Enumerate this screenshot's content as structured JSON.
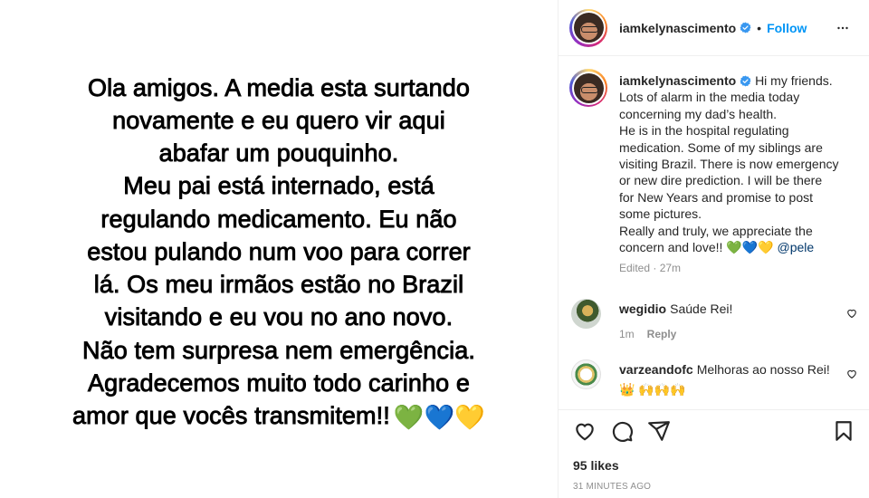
{
  "story": {
    "lines": [
      "Ola amigos. A media esta surtando",
      "novamente e eu quero vir aqui",
      "abafar um pouquinho.",
      "Meu pai está internado, está",
      "regulando medicamento. Eu não",
      "estou pulando num voo para correr",
      "lá. Os meu irmãos estão no Brazil",
      "visitando e eu vou no ano novo.",
      "Não tem surpresa nem emergência.",
      "Agradecemos muito todo carinho e",
      "amor que vocês transmitem!!"
    ],
    "hearts": "💚💙💛"
  },
  "header": {
    "username": "iamkelynascimento",
    "separator": "•",
    "follow_label": "Follow"
  },
  "caption": {
    "username": "iamkelynascimento",
    "lines": [
      "Hi my friends.",
      "Lots of alarm in the media today",
      "concerning my dad’s health.",
      "He is in the hospital regulating",
      "medication. Some of my siblings are",
      "visiting Brazil. There is now emergency",
      "or new dire prediction. I will be there",
      "for New Years and promise to post",
      "some pictures.",
      "Really and truly, we appreciate the",
      "concern and love!! 💚💙💛"
    ],
    "mention": "@pele",
    "meta": "Edited · 27m"
  },
  "comments": [
    {
      "username": "wegidio",
      "text": "Saúde Rei!",
      "time": "1m",
      "reply_label": "Reply"
    },
    {
      "username": "varzeandofc",
      "text": "Melhoras ao nosso Rei!",
      "second_line": "👑 🙌🙌🙌"
    }
  ],
  "footer": {
    "likes": "95 likes",
    "time_ago": "31 MINUTES AGO"
  },
  "colors": {
    "accent": "#0095f6",
    "verified": "#3897f0",
    "muted": "#8e8e8e",
    "mention": "#00376b"
  },
  "icons": [
    "verified-badge-icon",
    "more-options-icon",
    "heart-icon",
    "comment-icon",
    "share-icon",
    "bookmark-icon"
  ]
}
